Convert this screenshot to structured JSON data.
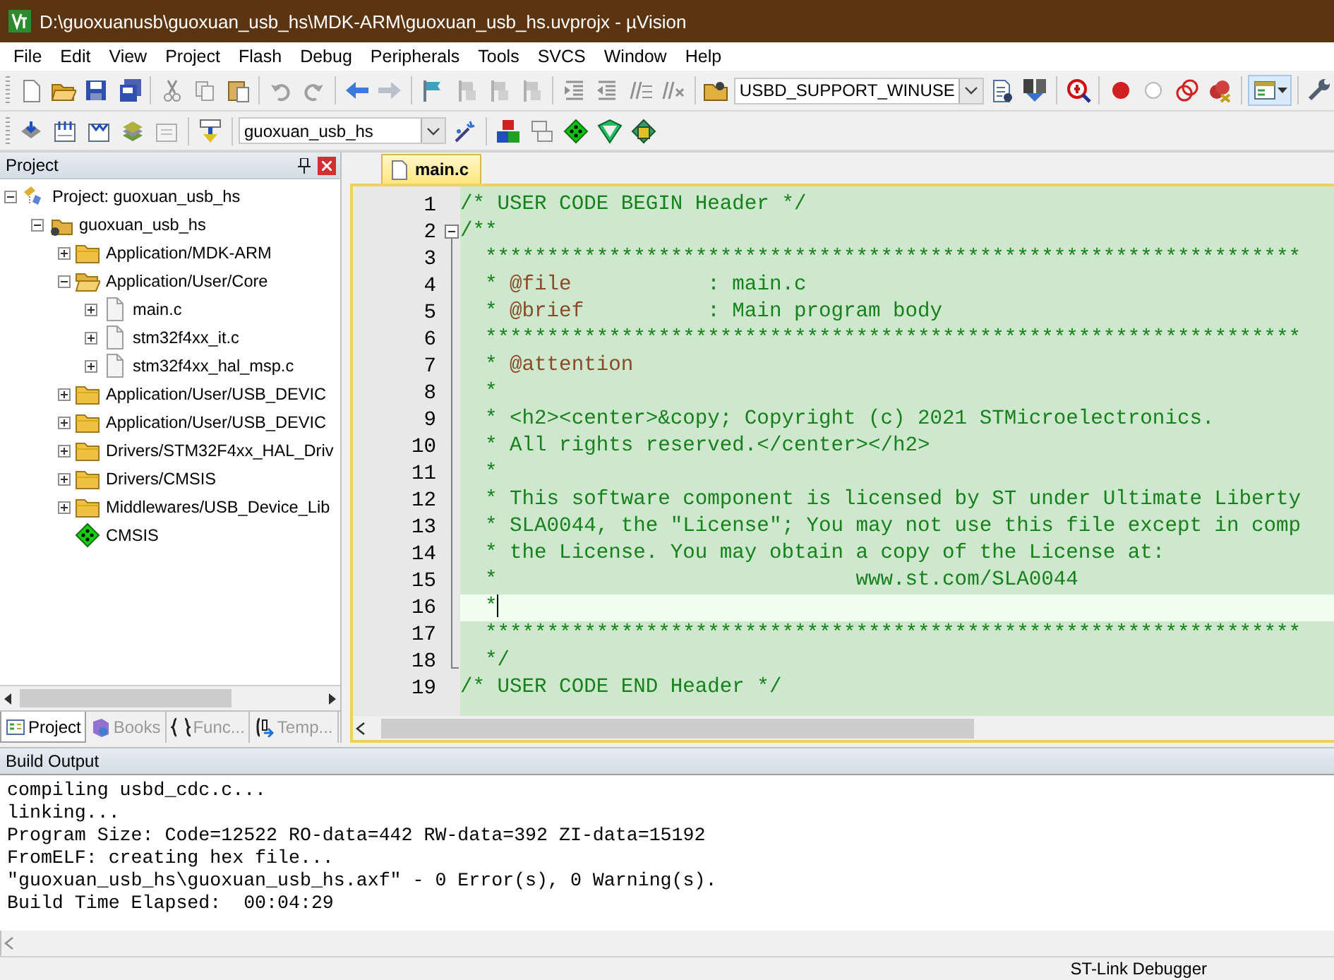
{
  "window": {
    "title": "D:\\guoxuanusb\\guoxuan_usb_hs\\MDK-ARM\\guoxuan_usb_hs.uvprojx - µVision"
  },
  "menu": [
    "File",
    "Edit",
    "View",
    "Project",
    "Flash",
    "Debug",
    "Peripherals",
    "Tools",
    "SVCS",
    "Window",
    "Help"
  ],
  "toolbar": {
    "find_dropdown": "USBD_SUPPORT_WINUSE"
  },
  "build_toolbar": {
    "target_dropdown": "guoxuan_usb_hs"
  },
  "project_panel": {
    "title": "Project",
    "tree": [
      {
        "label": "Project: guoxuan_usb_hs",
        "kind": "project",
        "expanded": true,
        "children": [
          {
            "label": "guoxuan_usb_hs",
            "kind": "target",
            "expanded": true,
            "children": [
              {
                "label": "Application/MDK-ARM",
                "kind": "folder",
                "expanded": false
              },
              {
                "label": "Application/User/Core",
                "kind": "folder",
                "expanded": true,
                "children": [
                  {
                    "label": "main.c",
                    "kind": "file",
                    "expanded": false
                  },
                  {
                    "label": "stm32f4xx_it.c",
                    "kind": "file",
                    "expanded": false
                  },
                  {
                    "label": "stm32f4xx_hal_msp.c",
                    "kind": "file",
                    "expanded": false
                  }
                ]
              },
              {
                "label": "Application/User/USB_DEVIC",
                "kind": "folder",
                "expanded": false
              },
              {
                "label": "Application/User/USB_DEVIC",
                "kind": "folder",
                "expanded": false
              },
              {
                "label": "Drivers/STM32F4xx_HAL_Driv",
                "kind": "folder",
                "expanded": false
              },
              {
                "label": "Drivers/CMSIS",
                "kind": "folder",
                "expanded": false
              },
              {
                "label": "Middlewares/USB_Device_Lib",
                "kind": "folder",
                "expanded": false
              },
              {
                "label": "CMSIS",
                "kind": "component"
              }
            ]
          }
        ]
      }
    ],
    "tabs": [
      {
        "label": "Project",
        "kind": "project",
        "selected": true
      },
      {
        "label": "Books",
        "kind": "books",
        "selected": false
      },
      {
        "label": "Func...",
        "kind": "functions",
        "selected": false
      },
      {
        "label": "Temp...",
        "kind": "templates",
        "selected": false
      }
    ]
  },
  "editor": {
    "tabs": [
      {
        "label": "main.c",
        "selected": true
      }
    ],
    "lines": [
      {
        "number": "1",
        "current": false,
        "parts": [
          {
            "kind": "comment",
            "text": "/* USER CODE BEGIN Header */"
          }
        ]
      },
      {
        "number": "2",
        "current": false,
        "parts": [
          {
            "kind": "comment",
            "text": "/**"
          }
        ]
      },
      {
        "number": "3",
        "current": false,
        "parts": [
          {
            "kind": "comment",
            "text": "  ******************************************************************"
          }
        ]
      },
      {
        "number": "4",
        "current": false,
        "parts": [
          {
            "kind": "comment",
            "text": "  * "
          },
          {
            "kind": "tag",
            "text": "@file"
          },
          {
            "kind": "comment",
            "text": "           : main.c"
          }
        ]
      },
      {
        "number": "5",
        "current": false,
        "parts": [
          {
            "kind": "comment",
            "text": "  * "
          },
          {
            "kind": "tag",
            "text": "@brief"
          },
          {
            "kind": "comment",
            "text": "          : Main program body"
          }
        ]
      },
      {
        "number": "6",
        "current": false,
        "parts": [
          {
            "kind": "comment",
            "text": "  ******************************************************************"
          }
        ]
      },
      {
        "number": "7",
        "current": false,
        "parts": [
          {
            "kind": "comment",
            "text": "  * "
          },
          {
            "kind": "tag",
            "text": "@attention"
          }
        ]
      },
      {
        "number": "8",
        "current": false,
        "parts": [
          {
            "kind": "comment",
            "text": "  *"
          }
        ]
      },
      {
        "number": "9",
        "current": false,
        "parts": [
          {
            "kind": "comment",
            "text": "  * <h2><center>&copy; Copyright (c) 2021 STMicroelectronics."
          }
        ]
      },
      {
        "number": "10",
        "current": false,
        "parts": [
          {
            "kind": "comment",
            "text": "  * All rights reserved.</center></h2>"
          }
        ]
      },
      {
        "number": "11",
        "current": false,
        "parts": [
          {
            "kind": "comment",
            "text": "  *"
          }
        ]
      },
      {
        "number": "12",
        "current": false,
        "parts": [
          {
            "kind": "comment",
            "text": "  * This software component is licensed by ST under Ultimate Liberty"
          }
        ]
      },
      {
        "number": "13",
        "current": false,
        "parts": [
          {
            "kind": "comment",
            "text": "  * SLA0044, the \"License\"; You may not use this file except in comp"
          }
        ]
      },
      {
        "number": "14",
        "current": false,
        "parts": [
          {
            "kind": "comment",
            "text": "  * the License. You may obtain a copy of the License at:"
          }
        ]
      },
      {
        "number": "15",
        "current": false,
        "parts": [
          {
            "kind": "comment",
            "text": "  *                             www.st.com/SLA0044"
          }
        ]
      },
      {
        "number": "16",
        "current": true,
        "parts": [
          {
            "kind": "comment",
            "text": "  *"
          }
        ]
      },
      {
        "number": "17",
        "current": false,
        "parts": [
          {
            "kind": "comment",
            "text": "  ******************************************************************"
          }
        ]
      },
      {
        "number": "18",
        "current": false,
        "parts": [
          {
            "kind": "comment",
            "text": "  */"
          }
        ]
      },
      {
        "number": "19",
        "current": false,
        "parts": [
          {
            "kind": "comment",
            "text": "/* USER CODE END Header */"
          }
        ]
      }
    ]
  },
  "build_output": {
    "title": "Build Output",
    "lines": [
      "compiling usbd_cdc.c...",
      "linking...",
      "Program Size: Code=12522 RO-data=442 RW-data=392 ZI-data=15192",
      "FromELF: creating hex file...",
      "\"guoxuan_usb_hs\\guoxuan_usb_hs.axf\" - 0 Error(s), 0 Warning(s).",
      "Build Time Elapsed:  00:04:29"
    ]
  },
  "status_bar": {
    "debugger": "ST-Link Debugger"
  }
}
